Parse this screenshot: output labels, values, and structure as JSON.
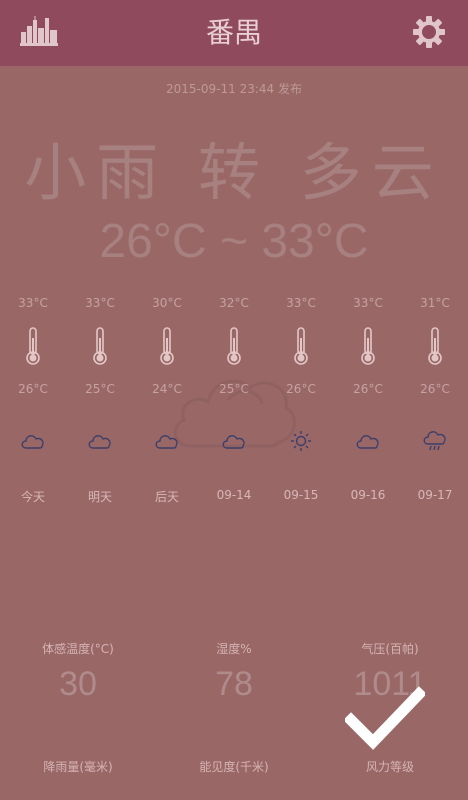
{
  "header": {
    "title": "番禺",
    "city_icon": "city-skyline-icon",
    "settings_icon": "gear-icon",
    "bar_color": "#8f4a5e"
  },
  "summary": {
    "published": "2015-09-11 23:44 发布",
    "condition": "小雨 转 多云",
    "temp_range": "26°C ~ 33°C"
  },
  "forecast": [
    {
      "high": "33°C",
      "low": "26°C",
      "day": "今天",
      "icon": "cloudy-icon"
    },
    {
      "high": "33°C",
      "low": "25°C",
      "day": "明天",
      "icon": "cloudy-icon"
    },
    {
      "high": "30°C",
      "low": "24°C",
      "day": "后天",
      "icon": "cloudy-icon"
    },
    {
      "high": "32°C",
      "low": "25°C",
      "day": "09-14",
      "icon": "cloudy-icon"
    },
    {
      "high": "33°C",
      "low": "26°C",
      "day": "09-15",
      "icon": "sunny-icon"
    },
    {
      "high": "33°C",
      "low": "26°C",
      "day": "09-16",
      "icon": "cloudy-icon"
    },
    {
      "high": "31°C",
      "low": "26°C",
      "day": "09-17",
      "icon": "rain-icon"
    }
  ],
  "stats": [
    {
      "label": "体感温度(°C)",
      "value": "30"
    },
    {
      "label": "湿度%",
      "value": "78"
    },
    {
      "label": "气压(百帕)",
      "value": "1011"
    },
    {
      "label": "降雨量(毫米)",
      "value": ""
    },
    {
      "label": "能见度(千米)",
      "value": ""
    },
    {
      "label": "风力等级",
      "value": ""
    }
  ],
  "overlay": {
    "icon": "checkmark-icon"
  }
}
